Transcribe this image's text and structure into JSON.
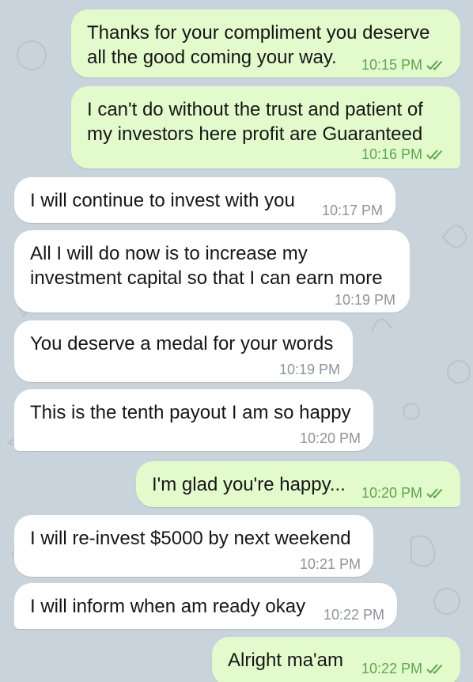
{
  "messages": [
    {
      "dir": "out",
      "text": "Thanks for your compliment you deserve\nall the good coming your way.",
      "time": "10:15 PM",
      "read": true
    },
    {
      "dir": "out",
      "text": "I can't do without the trust and patient of\nmy investors here profit are Guaranteed",
      "time": "10:16 PM",
      "read": true
    },
    {
      "dir": "in",
      "text": "I will continue to invest with you",
      "time": "10:17 PM"
    },
    {
      "dir": "in",
      "text": "All I will do now is to increase my\ninvestment capital so that I can earn more",
      "time": "10:19 PM"
    },
    {
      "dir": "in",
      "text": "You deserve a medal for your words",
      "time": "10:19 PM"
    },
    {
      "dir": "in",
      "text": "This is the tenth payout I am so happy",
      "time": "10:20 PM"
    },
    {
      "dir": "out",
      "text": "I'm glad you're happy...",
      "time": "10:20 PM",
      "read": true
    },
    {
      "dir": "in",
      "text": "I will re-invest $5000 by next weekend",
      "time": "10:21 PM"
    },
    {
      "dir": "in",
      "text": "I will inform when am ready okay",
      "time": "10:22 PM"
    },
    {
      "dir": "out",
      "text": "Alright ma'am",
      "time": "10:22 PM",
      "read": true
    }
  ],
  "colors": {
    "background": "#c9d3dc",
    "outgoing_bubble": "#e3fbcc",
    "incoming_bubble": "#ffffff",
    "outgoing_meta": "#5ea452",
    "incoming_meta": "#8e9399"
  }
}
